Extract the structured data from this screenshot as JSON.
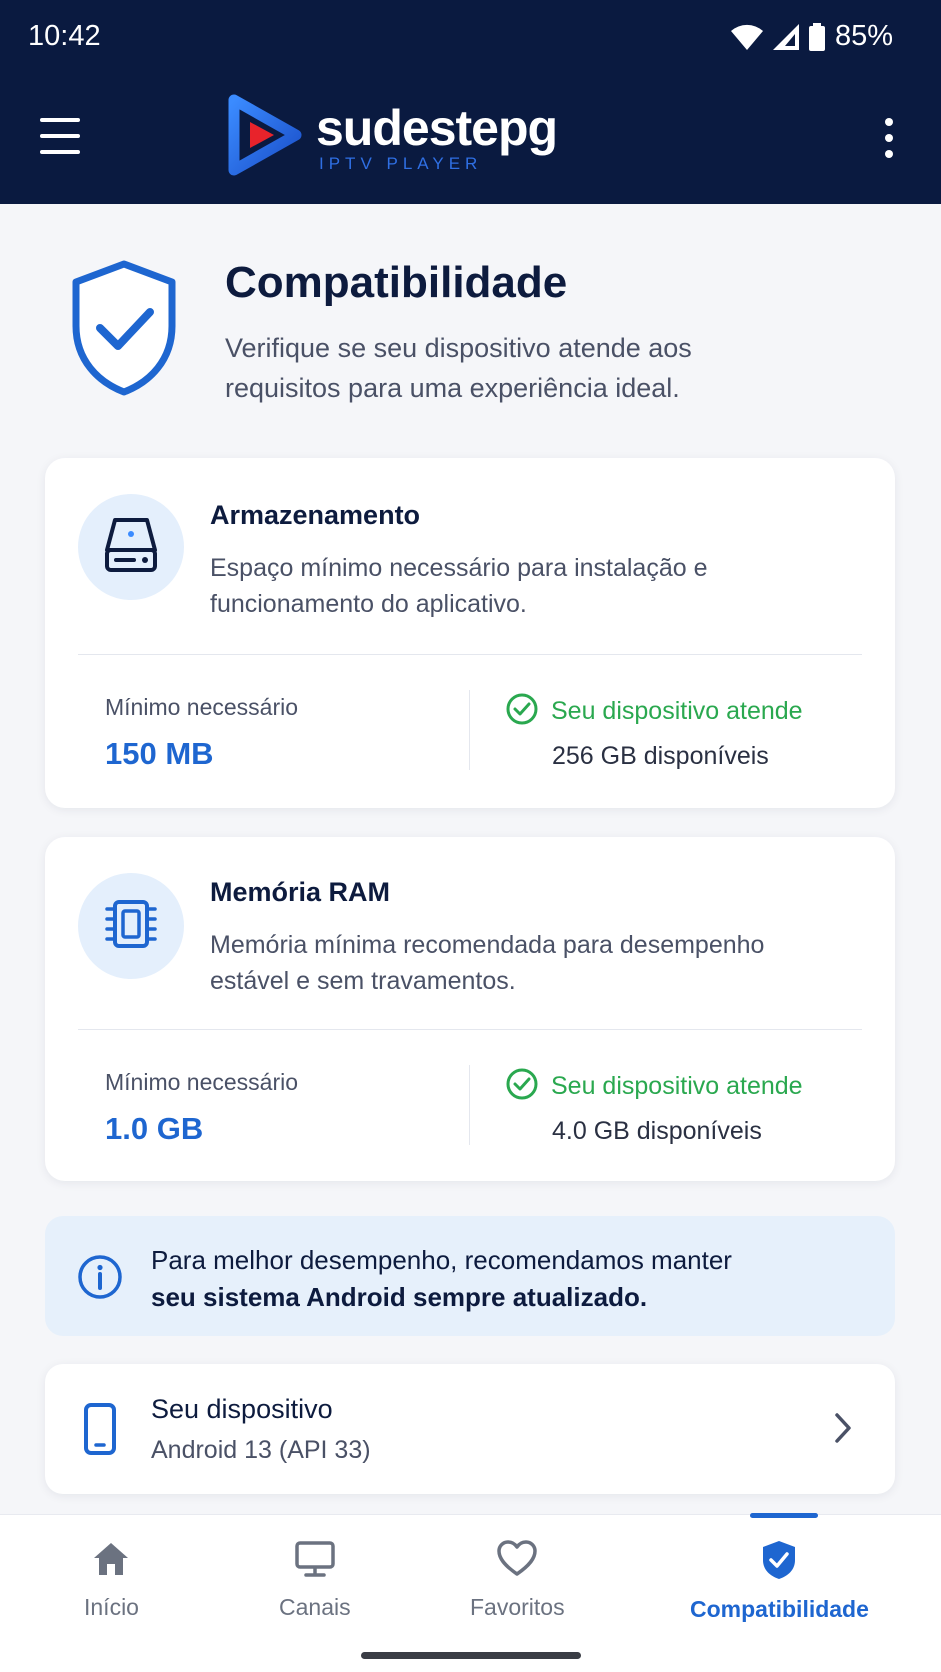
{
  "status_bar": {
    "time": "10:42",
    "battery": "85%"
  },
  "header": {
    "brand": "sudestepg",
    "brand_sub": "IPTV PLAYER"
  },
  "page": {
    "title": "Compatibilidade",
    "description": "Verifique se seu dispositivo atende aos requisitos para uma experiência ideal."
  },
  "cards": [
    {
      "title": "Armazenamento",
      "description": "Espaço mínimo necessário para instalação e funcionamento do aplicativo.",
      "min_label": "Mínimo necessário",
      "min_value": "150 MB",
      "status": "Seu dispositivo atende",
      "available": "256 GB disponíveis"
    },
    {
      "title": "Memória RAM",
      "description": "Memória mínima recomendada para desempenho estável e sem travamentos.",
      "min_label": "Mínimo necessário",
      "min_value": "1.0 GB",
      "status": "Seu dispositivo atende",
      "available": "4.0 GB disponíveis"
    }
  ],
  "info": {
    "text_normal": "Para melhor desempenho, recomendamos manter",
    "text_bold": "seu sistema Android sempre atualizado."
  },
  "device": {
    "title": "Seu dispositivo",
    "subtitle": "Android 13 (API 33)"
  },
  "nav": [
    {
      "label": "Início",
      "icon": "home-icon"
    },
    {
      "label": "Canais",
      "icon": "tv-icon"
    },
    {
      "label": "Favoritos",
      "icon": "heart-icon"
    },
    {
      "label": "Compatibilidade",
      "icon": "shield-check-icon",
      "active": true
    }
  ],
  "colors": {
    "header_bg": "#0a1a40",
    "accent": "#1e66d0",
    "success": "#2aa84f",
    "info_bg": "#e6f0fb"
  }
}
